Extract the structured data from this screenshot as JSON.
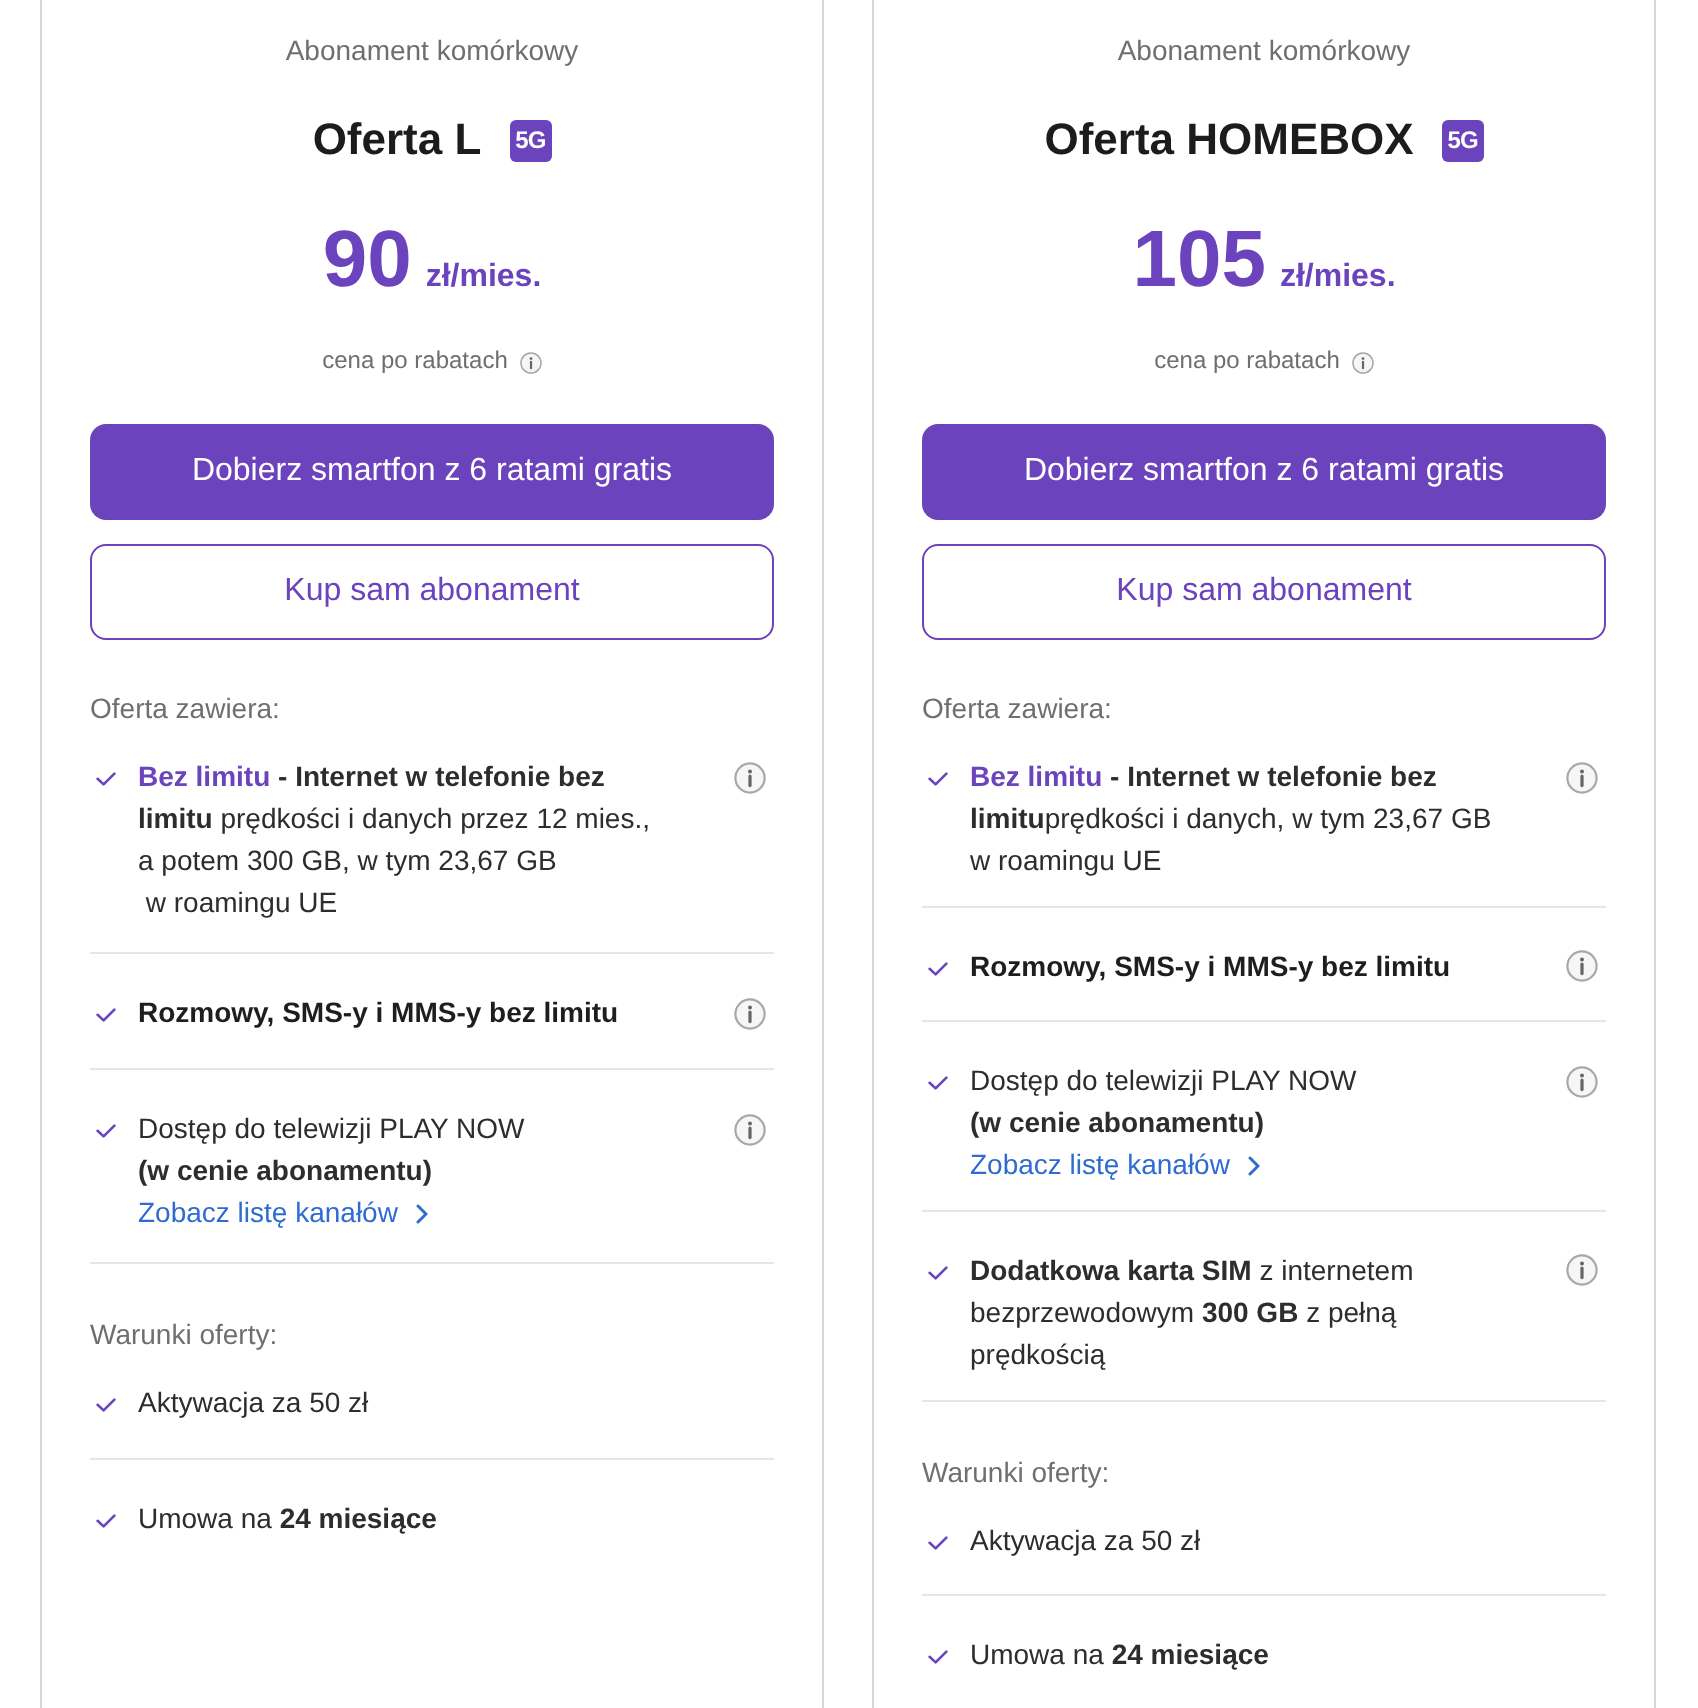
{
  "plans": [
    {
      "category": "Abonament komórkowy",
      "name": "Oferta L",
      "badge": "5G",
      "price": "90",
      "price_unit": "zł/mies.",
      "price_note": "cena po rabatach",
      "buttons": [
        {
          "kind": "primary",
          "label": "Dobierz smartfon z 6 ratami gratis"
        },
        {
          "kind": "outline",
          "label": "Kup sam abonament"
        }
      ],
      "features_heading": "Oferta zawiera:",
      "features": [
        {
          "highlight": "Bez limitu",
          "text": " **- Internet w telefonie bez limitu** prędkości i danych przez 12 mies., a potem 300 GB, w tym 23,67 GB\n w roamingu UE",
          "bold": false
        },
        {
          "text": "Rozmowy, SMS-y i MMS-y bez limitu",
          "bold": true
        },
        {
          "text": "Dostęp do telewizji PLAY NOW\n**(w cenie abonamentu)**",
          "link": "Zobacz listę kanałów",
          "bold": false
        }
      ],
      "conditions_heading": "Warunki oferty:",
      "conditions": [
        {
          "text": "Aktywacja za 50 zł"
        },
        {
          "text": "Umowa na **24 miesiące**"
        }
      ]
    },
    {
      "category": "Abonament komórkowy",
      "name": "Oferta HOMEBOX",
      "badge": "5G",
      "price": "105",
      "price_unit": "zł/mies.",
      "price_note": "cena po rabatach",
      "buttons": [
        {
          "kind": "primary",
          "label": "Dobierz smartfon z 6 ratami gratis"
        },
        {
          "kind": "outline",
          "label": "Kup sam abonament"
        }
      ],
      "features_heading": "Oferta zawiera:",
      "features": [
        {
          "highlight": "Bez limitu",
          "text": " **- Internet w telefonie bez limitu**prędkości i danych, w tym 23,67 GB w roamingu UE",
          "bold": false
        },
        {
          "text": "Rozmowy, SMS-y i MMS-y bez limitu",
          "bold": true
        },
        {
          "text": "Dostęp do telewizji PLAY NOW\n**(w cenie abonamentu)**",
          "link": "Zobacz listę kanałów",
          "bold": false
        },
        {
          "text": "**Dodatkowa karta SIM** z internetem bezprzewodowym **300 GB** z pełną prędkością",
          "bold": false
        }
      ],
      "conditions_heading": "Warunki oferty:",
      "conditions": [
        {
          "text": "Aktywacja za 50 zł"
        },
        {
          "text": "Umowa na **24 miesiące**"
        }
      ]
    }
  ]
}
